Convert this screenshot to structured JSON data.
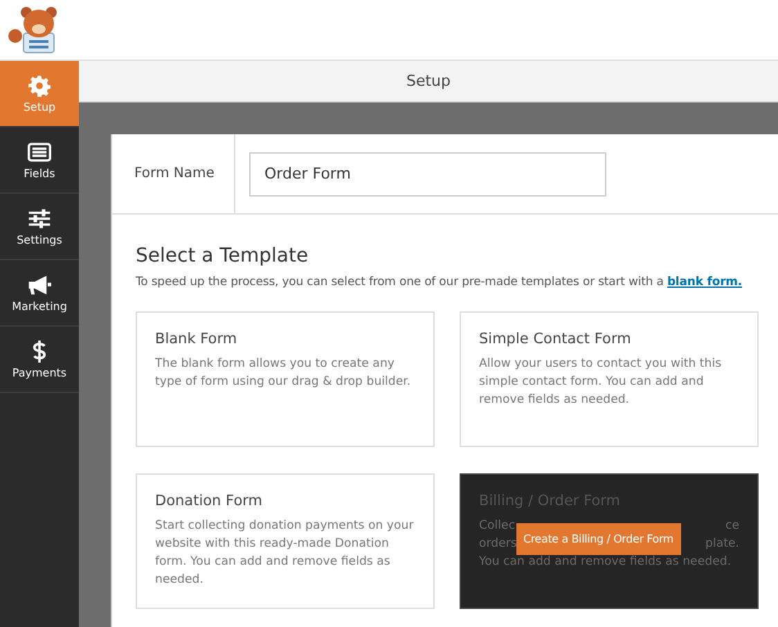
{
  "sidebar": {
    "items": [
      {
        "label": "Setup",
        "selected": true
      },
      {
        "label": "Fields",
        "selected": false
      },
      {
        "label": "Settings",
        "selected": false
      },
      {
        "label": "Marketing",
        "selected": false
      },
      {
        "label": "Payments",
        "selected": false
      }
    ]
  },
  "top_bar": {
    "title": "Setup"
  },
  "form_name": {
    "label": "Form Name",
    "value": "Order Form"
  },
  "templates": {
    "heading": "Select a Template",
    "intro": "To speed up the process, you can select from one of our pre-made templates or start with a",
    "intro_link": "blank form.",
    "cards": [
      {
        "title": "Blank Form",
        "description": "The blank form allows you to create any type of form using our drag & drop builder.",
        "hovered": false
      },
      {
        "title": "Simple Contact Form",
        "description": "Allow your users to contact you with this simple contact form. You can add and remove fields as needed.",
        "hovered": false
      },
      {
        "title": "Donation Form",
        "description": "Start collecting donation payments on your website with this ready-made Donation form. You can add and remove fields as needed.",
        "hovered": false
      },
      {
        "title": "Billing / Order Form",
        "hovered": true,
        "visible_lines": [
          {
            "left": "Collec",
            "right": "ce"
          },
          {
            "left": "orders",
            "right": "plate."
          },
          {
            "left": "You can add and remove fields as needed."
          }
        ],
        "button": "Create a Billing / Order Form"
      }
    ]
  }
}
